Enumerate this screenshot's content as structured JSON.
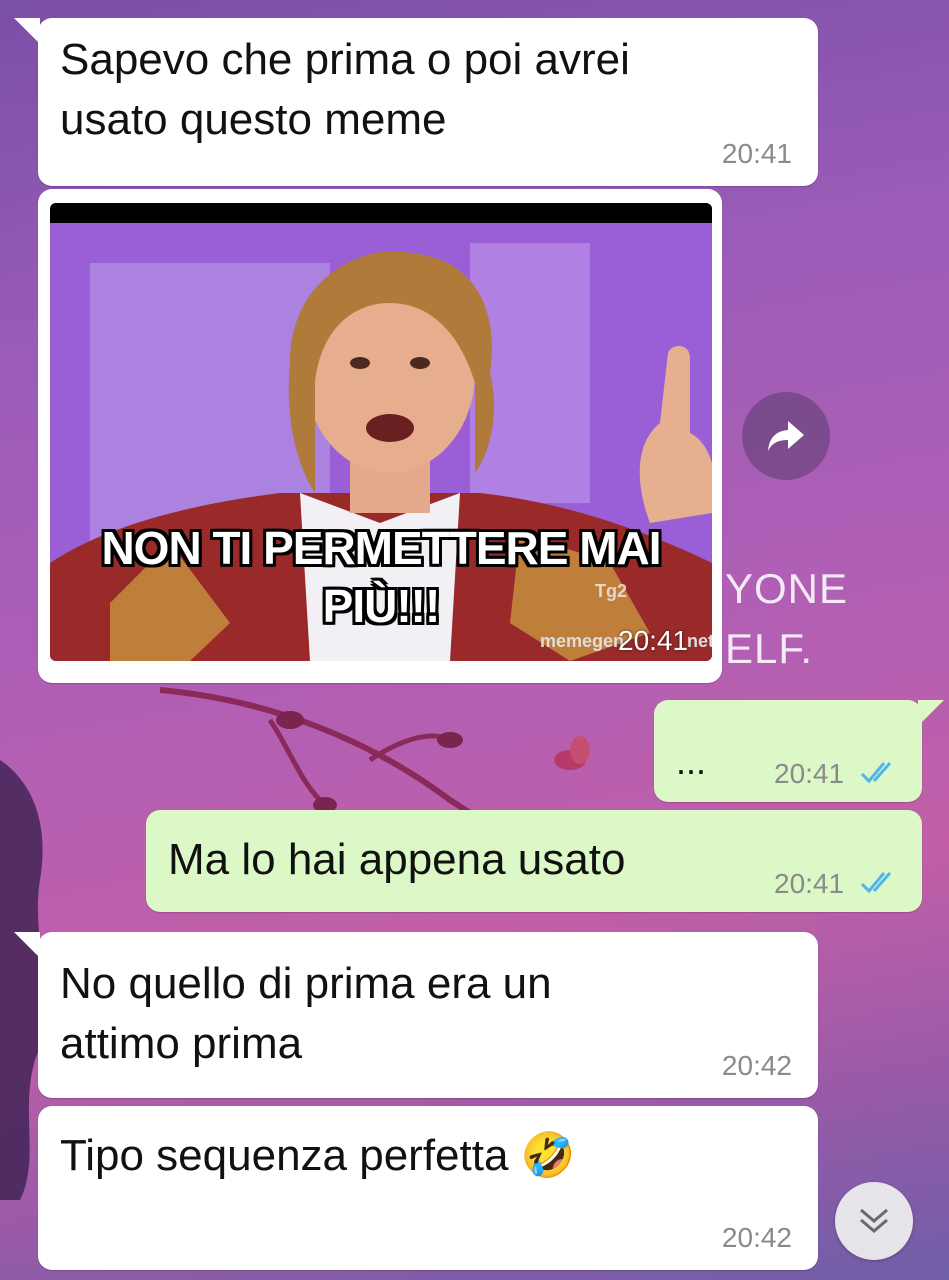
{
  "wallpaper": {
    "text_line1": "YONE",
    "text_line2": "ELF."
  },
  "messages": [
    {
      "direction": "incoming",
      "text_line1": "Sapevo che prima o poi avrei",
      "text_line2": "usato questo meme",
      "time": "20:41"
    },
    {
      "direction": "incoming",
      "type": "image",
      "caption_line1": "NON TI PERMETTERE MAI",
      "caption_line2": "PIÙ!!!",
      "watermark": "memegen",
      "watermark_tail": "net",
      "channel_logo": "Tg2",
      "time": "20:41"
    },
    {
      "direction": "outgoing",
      "text": "...",
      "time": "20:41",
      "status": "read"
    },
    {
      "direction": "outgoing",
      "text": "Ma lo hai appena usato",
      "time": "20:41",
      "status": "read"
    },
    {
      "direction": "incoming",
      "text_line1": "No quello di prima era un",
      "text_line2": "attimo prima",
      "time": "20:42"
    },
    {
      "direction": "incoming",
      "text": "Tipo sequenza perfetta 🤣",
      "time": "20:42"
    }
  ],
  "colors": {
    "incoming_bubble": "#ffffff",
    "outgoing_bubble": "#dcf8c6",
    "read_ticks": "#4fb6ec"
  },
  "icons": {
    "forward": "forward-arrow-icon",
    "scroll_down": "double-chevron-down-icon",
    "read_receipt": "double-check-icon"
  }
}
